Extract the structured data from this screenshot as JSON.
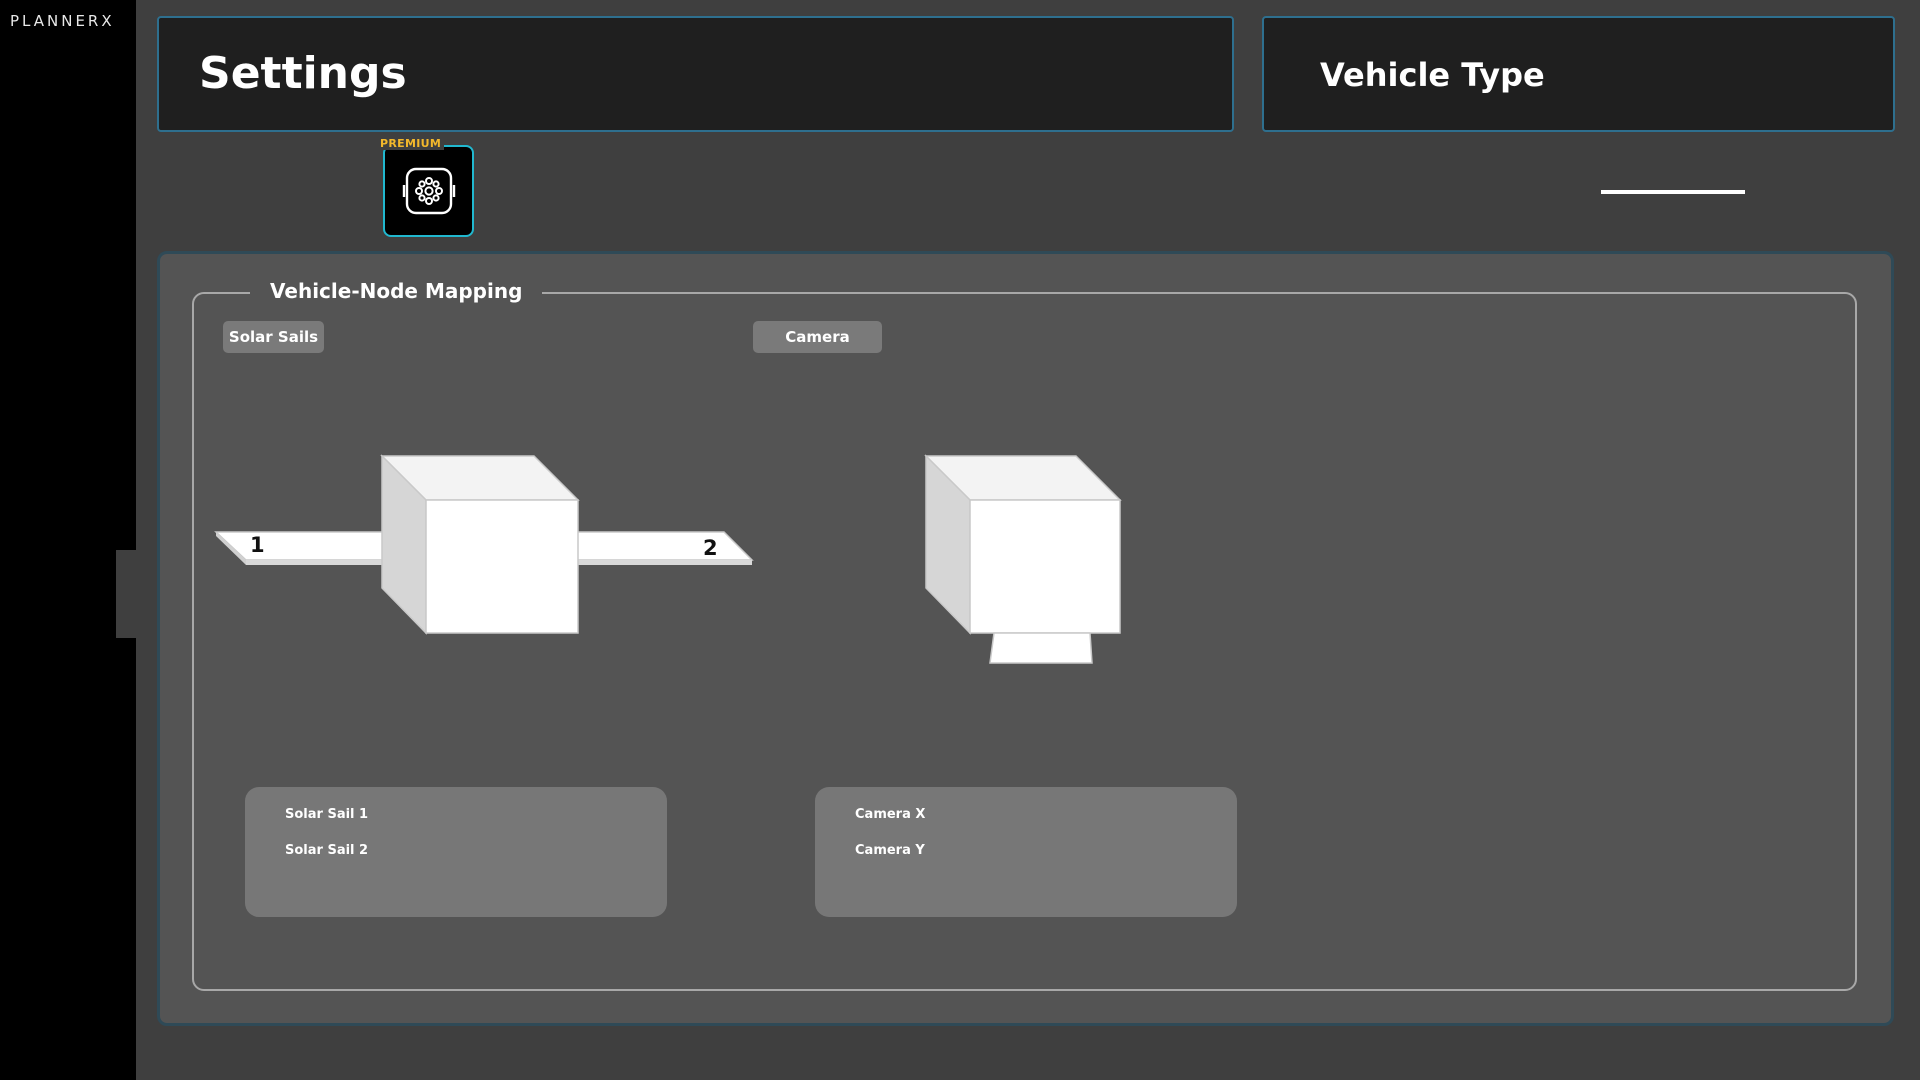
{
  "app": {
    "logo_text": "PLANNERX"
  },
  "header": {
    "title": "Settings",
    "vehicle_type_label": "Vehicle Type"
  },
  "premium": {
    "badge": "PREMIUM",
    "icon": "gear-cluster-icon",
    "accent_color": "#21b8cf",
    "badge_color": "#f3b82b"
  },
  "mapping": {
    "legend": "Vehicle-Node Mapping",
    "groups": [
      {
        "chip_label": "Solar Sails",
        "sail_numbers": [
          "1",
          "2"
        ],
        "nodes": [
          "Solar Sail 1",
          "Solar Sail 2"
        ]
      },
      {
        "chip_label": "Camera",
        "nodes": [
          "Camera X",
          "Camera Y"
        ]
      }
    ]
  },
  "colors": {
    "background": "#3f3f3f",
    "panel": "#545454",
    "header_border": "#2e6f8e"
  }
}
